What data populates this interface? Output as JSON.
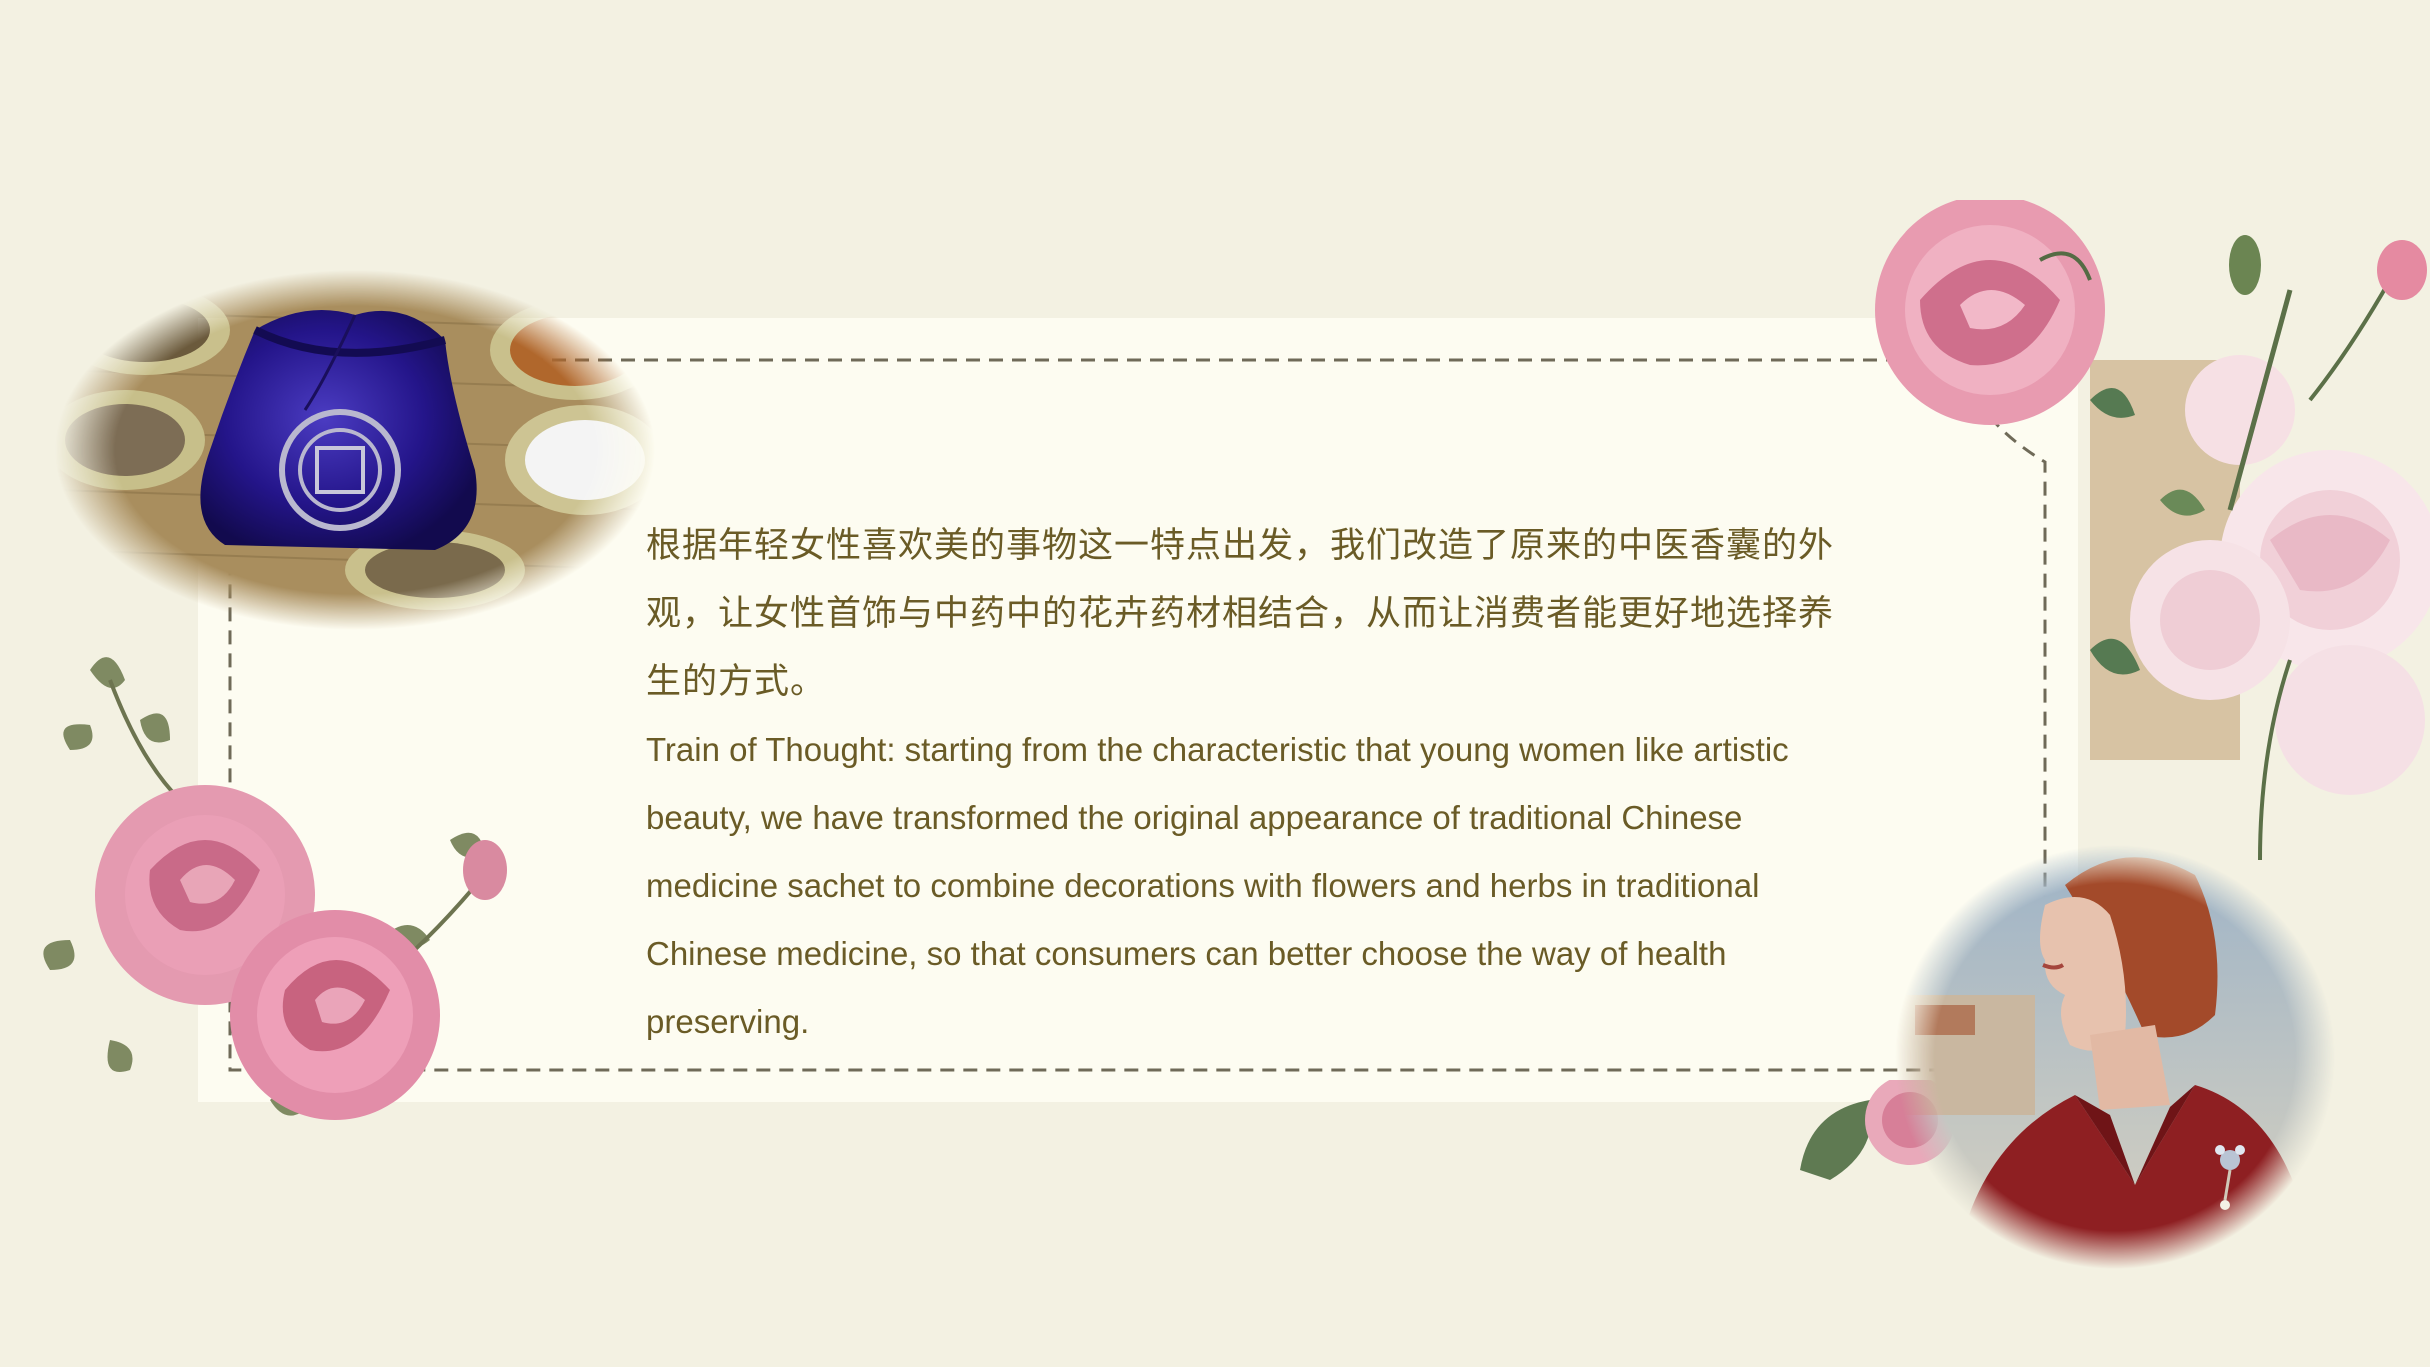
{
  "slide": {
    "paragraph_cn": "根据年轻女性喜欢美的事物这一特点出发，我们改造了原来的中医香囊的外观，让女性首饰与中药中的花卉药材相结合，从而让消费者能更好地选择养生的方式。",
    "paragraph_en": "Train of Thought: starting from the characteristic that young women like artistic beauty, we have transformed the original appearance of traditional Chinese medicine sachet to combine decorations with flowers and herbs in traditional Chinese medicine, so that consumers can better choose the way of health preserving."
  },
  "images": {
    "herb_photo": "blue-sachet-with-herb-bowls",
    "roses_left": "pink-roses-illustration",
    "flowers_right": "pink-and-white-flowers-illustration",
    "woman_photo": "woman-in-red-jacket-with-brooch"
  },
  "colors": {
    "background": "#f3f1e2",
    "card": "#fdfcf1",
    "text": "#6a5b26",
    "dash": "#6f6a58"
  }
}
